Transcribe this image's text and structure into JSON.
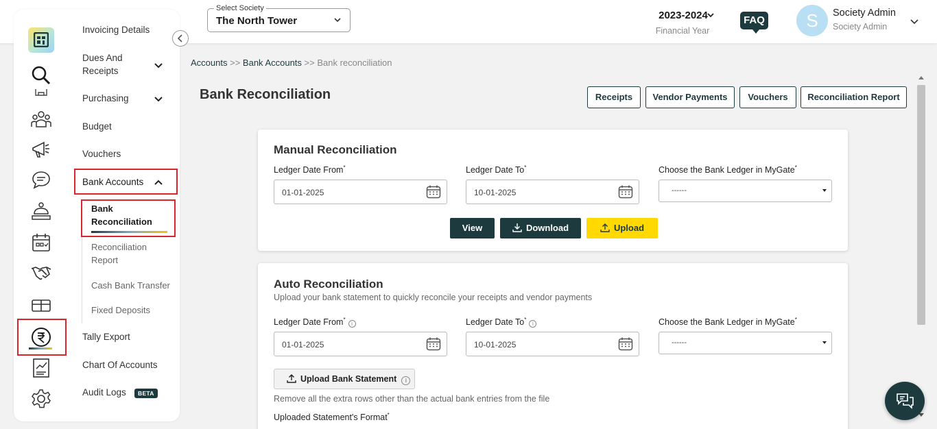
{
  "header": {
    "society_label": "Select Society",
    "society_value": "The North Tower",
    "financial_year": "2023-2024",
    "financial_year_caption": "Financial Year",
    "faq": "FAQ",
    "avatar_initial": "S",
    "user_name": "Society Admin",
    "user_role": "Society Admin"
  },
  "sidebar": {
    "rail_icons": [
      "search-icon",
      "building-icon",
      "people-icon",
      "megaphone-icon",
      "chat-bubble-icon",
      "service-bell-icon",
      "calendar-icon",
      "handshake-icon",
      "gift-box-icon",
      "rupee-icon",
      "report-chart-icon",
      "settings-gear-icon"
    ],
    "menu": {
      "invoicing": "Invoicing Details",
      "dues": "Dues And Receipts",
      "purchasing": "Purchasing",
      "budget": "Budget",
      "vouchers": "Vouchers",
      "bank_accounts": "Bank Accounts",
      "tally": "Tally Export",
      "chart": "Chart Of Accounts",
      "audit": "Audit Logs",
      "beta": "BETA"
    },
    "bank_submenu": {
      "reconciliation_line1": "Bank",
      "reconciliation_line2": "Reconciliation",
      "report_line1": "Reconciliation",
      "report_line2": "Report",
      "cash_transfer": "Cash Bank Transfer",
      "fixed_deposits": "Fixed Deposits"
    }
  },
  "breadcrumb": {
    "accounts": "Accounts",
    "sep": ">>",
    "bank_accounts": "Bank Accounts",
    "current": "Bank reconciliation"
  },
  "page": {
    "title": "Bank Reconciliation",
    "buttons": {
      "receipts": "Receipts",
      "vendor_payments": "Vendor Payments",
      "vouchers": "Vouchers",
      "reconciliation_report": "Reconciliation Report"
    }
  },
  "manual": {
    "title": "Manual Reconciliation",
    "ledger_from_label": "Ledger Date From",
    "ledger_from_value": "01-01-2025",
    "ledger_to_label": "Ledger Date To",
    "ledger_to_value": "10-01-2025",
    "bank_ledger_label": "Choose the Bank Ledger in MyGate",
    "bank_ledger_value": "------",
    "view": "View",
    "download": "Download",
    "upload": "Upload"
  },
  "auto": {
    "title": "Auto Reconciliation",
    "subtitle": "Upload your bank statement to quickly reconcile your receipts and vendor payments",
    "ledger_from_label": "Ledger Date From",
    "ledger_from_value": "01-01-2025",
    "ledger_to_label": "Ledger Date To",
    "ledger_to_value": "10-01-2025",
    "bank_ledger_label": "Choose the Bank Ledger in MyGate",
    "bank_ledger_value": "------",
    "upload_statement": "Upload Bank Statement",
    "hint": "Remove all the extra rows other than the actual bank entries from the file",
    "format_label": "Uploaded Statement's Format"
  },
  "required_mark": "*",
  "info_mark": "i",
  "colors": {
    "brand_dark": "#1d3a3e",
    "accent_yellow": "#ffd900",
    "highlight_red": "#d9252b"
  }
}
